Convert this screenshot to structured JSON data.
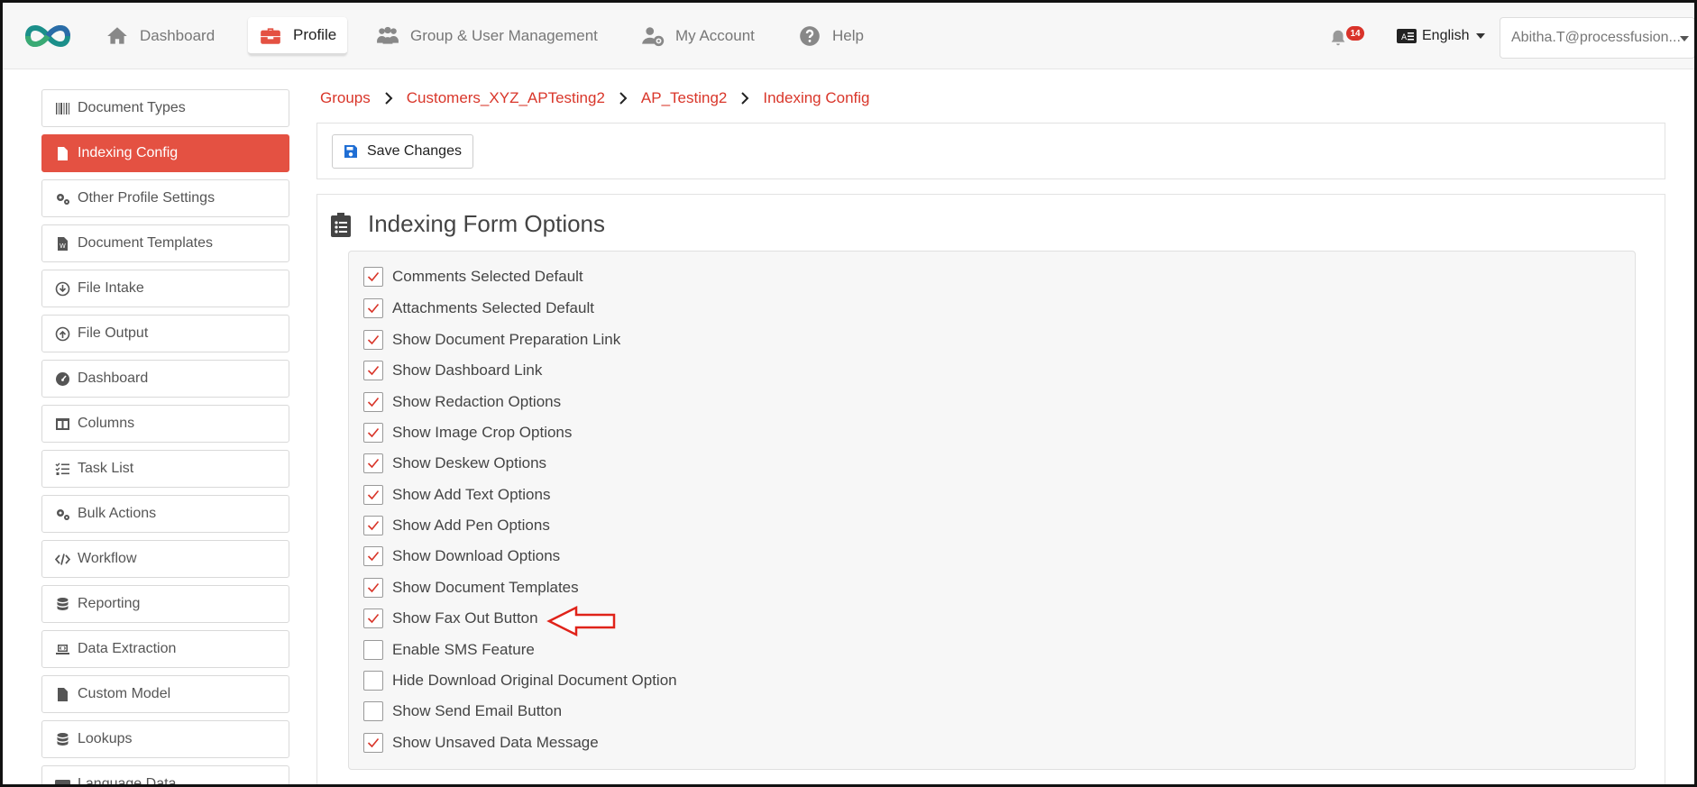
{
  "nav": {
    "items": [
      {
        "label": "Dashboard",
        "icon": "home-icon"
      },
      {
        "label": "Profile",
        "icon": "toolbox-icon",
        "active": true
      },
      {
        "label": "Group & User Management",
        "icon": "users-icon"
      },
      {
        "label": "My Account",
        "icon": "user-gear-icon"
      },
      {
        "label": "Help",
        "icon": "question-circle-icon"
      }
    ],
    "notification_count": "14",
    "language": "English",
    "user": "Abitha.T@processfusion..."
  },
  "sidebar": {
    "items": [
      {
        "label": "Document Types",
        "icon": "barcode-icon"
      },
      {
        "label": "Indexing Config",
        "icon": "file-icon",
        "active": true
      },
      {
        "label": "Other Profile Settings",
        "icon": "cogs-icon"
      },
      {
        "label": "Document Templates",
        "icon": "word-file-icon"
      },
      {
        "label": "File Intake",
        "icon": "arrow-circle-down-icon"
      },
      {
        "label": "File Output",
        "icon": "arrow-circle-up-icon"
      },
      {
        "label": "Dashboard",
        "icon": "gauge-icon"
      },
      {
        "label": "Columns",
        "icon": "columns-icon"
      },
      {
        "label": "Task List",
        "icon": "tasks-icon"
      },
      {
        "label": "Bulk Actions",
        "icon": "cogs-icon"
      },
      {
        "label": "Workflow",
        "icon": "code-icon"
      },
      {
        "label": "Reporting",
        "icon": "database-icon"
      },
      {
        "label": "Data Extraction",
        "icon": "laptop-code-icon"
      },
      {
        "label": "Custom Model",
        "icon": "file-alt-icon"
      },
      {
        "label": "Lookups",
        "icon": "database-icon"
      },
      {
        "label": "Language Data",
        "icon": "language-icon"
      }
    ]
  },
  "breadcrumb": [
    "Groups",
    "Customers_XYZ_APTesting2",
    "AP_Testing2",
    "Indexing Config"
  ],
  "toolbar": {
    "save_label": "Save Changes"
  },
  "panel": {
    "title": "Indexing Form Options",
    "options": [
      {
        "label": "Comments Selected Default",
        "checked": true
      },
      {
        "label": "Attachments Selected Default",
        "checked": true
      },
      {
        "label": "Show Document Preparation Link",
        "checked": true
      },
      {
        "label": "Show Dashboard Link",
        "checked": true
      },
      {
        "label": "Show Redaction Options",
        "checked": true
      },
      {
        "label": "Show Image Crop Options",
        "checked": true
      },
      {
        "label": "Show Deskew Options",
        "checked": true
      },
      {
        "label": "Show Add Text Options",
        "checked": true
      },
      {
        "label": "Show Add Pen Options",
        "checked": true
      },
      {
        "label": "Show Download Options",
        "checked": true
      },
      {
        "label": "Show Document Templates",
        "checked": true
      },
      {
        "label": "Show Fax Out Button",
        "checked": true
      },
      {
        "label": "Enable SMS Feature",
        "checked": false
      },
      {
        "label": "Hide Download Original Document Option",
        "checked": false
      },
      {
        "label": "Show Send Email Button",
        "checked": false
      },
      {
        "label": "Show Unsaved Data Message",
        "checked": true
      }
    ]
  },
  "colors": {
    "accent": "#e45142",
    "link": "#d9362a",
    "save_icon": "#1f6ed4",
    "check": "#d9362a",
    "badge": "#d9332a"
  }
}
